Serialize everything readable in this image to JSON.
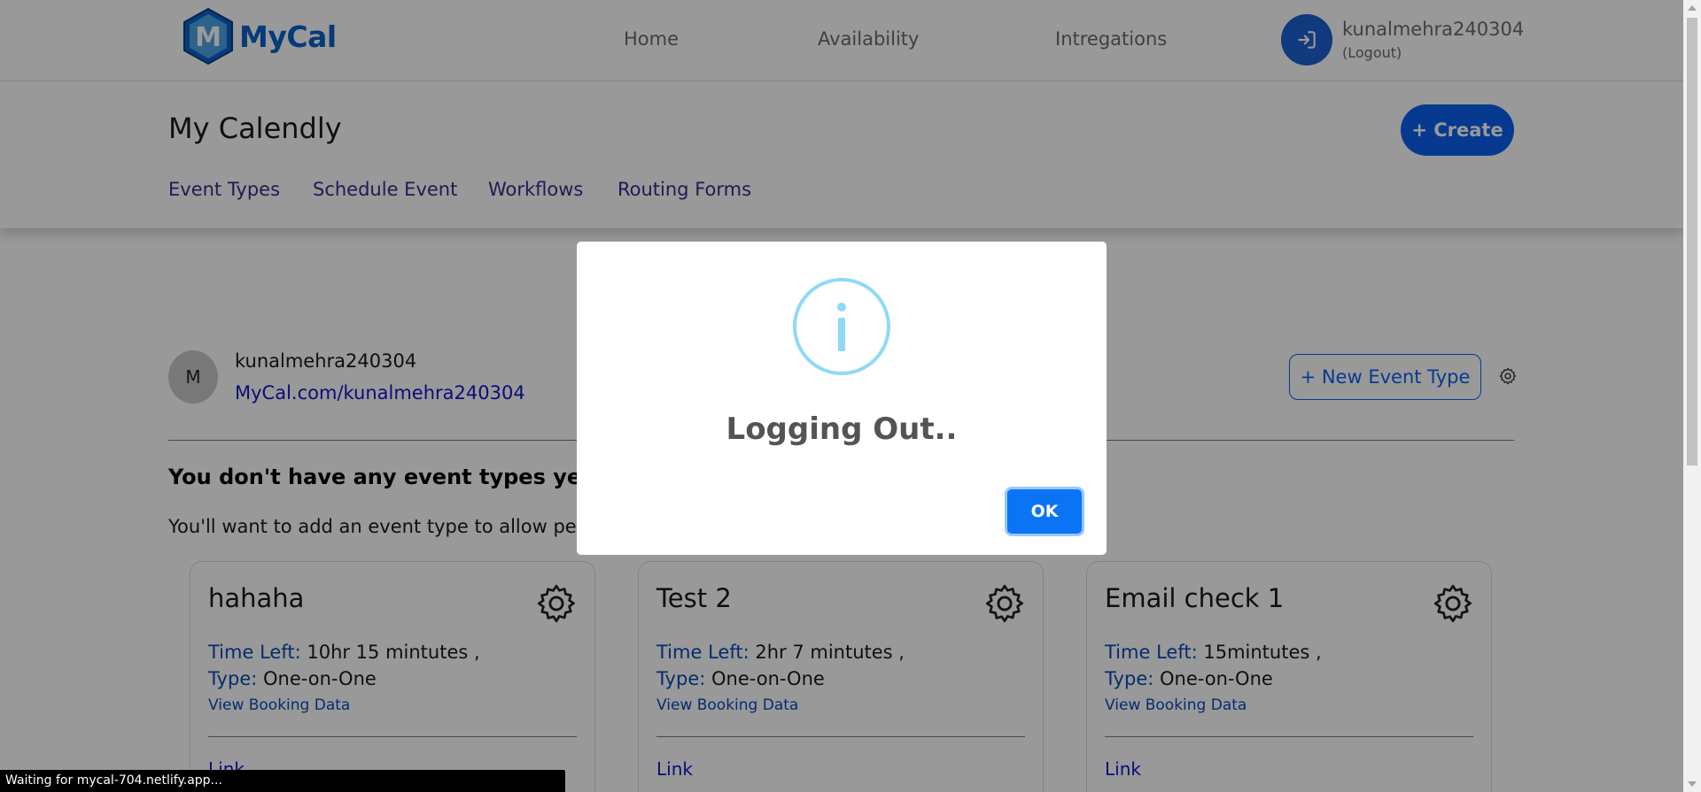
{
  "brand": {
    "name": "MyCal",
    "logo_letter": "M"
  },
  "nav": {
    "links": [
      "Home",
      "Availability",
      "Intregations"
    ],
    "user_name": "kunalmehra240304",
    "logout_label": "(Logout)"
  },
  "header": {
    "title": "My Calendly",
    "create_label": "+ Create",
    "tabs": [
      "Event Types",
      "Schedule Event",
      "Workflows",
      "Routing Forms"
    ]
  },
  "profile": {
    "initial": "M",
    "name": "kunalmehra240304",
    "link": "MyCal.com/kunalmehra240304",
    "new_event_label": "+ New Event Type"
  },
  "empty_state": {
    "title": "You don't have any event types yet.",
    "description": "You'll want to add an event type to allow peop"
  },
  "cards": [
    {
      "title": "hahaha",
      "time_left_label": "Time Left:",
      "time_left": "10hr 15 mintutes ,",
      "type_label": "Type:",
      "type": "One-on-One",
      "view_label": "View Booking Data",
      "link_label": "Link"
    },
    {
      "title": "Test 2",
      "time_left_label": "Time Left:",
      "time_left": "2hr 7 mintutes ,",
      "type_label": "Type:",
      "type": "One-on-One",
      "view_label": "View Booking Data",
      "link_label": "Link"
    },
    {
      "title": "Email check 1",
      "time_left_label": "Time Left:",
      "time_left": "15mintutes ,",
      "type_label": "Type:",
      "type": "One-on-One",
      "view_label": "View Booking Data",
      "link_label": "Link"
    }
  ],
  "modal": {
    "icon": "info-icon",
    "title": "Logging Out..",
    "ok_label": "OK"
  },
  "status_bar": {
    "text": "Waiting for mycal-704.netlify.app..."
  },
  "colors": {
    "accent": "#0a61f0",
    "brand": "#0a61c9",
    "info_icon": "#8fdaf5",
    "overlay": "rgba(0,0,0,0.4)"
  }
}
